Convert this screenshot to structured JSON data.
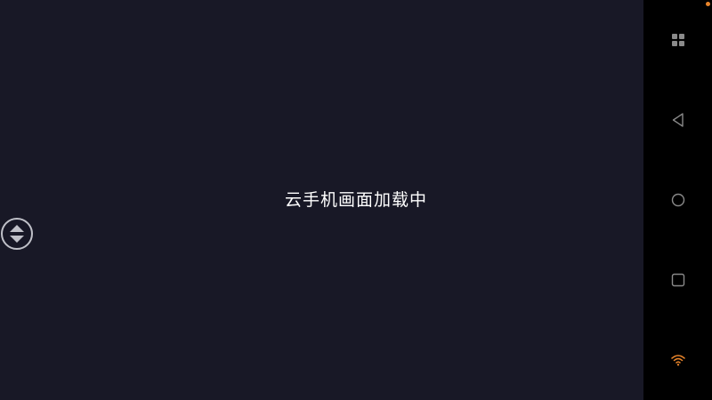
{
  "screen": {
    "loading_text": "云手机画面加载中"
  },
  "navbar": {
    "buttons": [
      {
        "icon": "menu-grid-icon"
      },
      {
        "icon": "back-triangle-icon"
      },
      {
        "icon": "home-circle-icon"
      },
      {
        "icon": "recents-square-icon"
      },
      {
        "icon": "wifi-signal-icon"
      }
    ]
  },
  "colors": {
    "background": "#181826",
    "navbar": "#000000",
    "nav_icon": "#8a8a8a",
    "wifi": "#e8842a",
    "status_dot": "#e8842a"
  }
}
